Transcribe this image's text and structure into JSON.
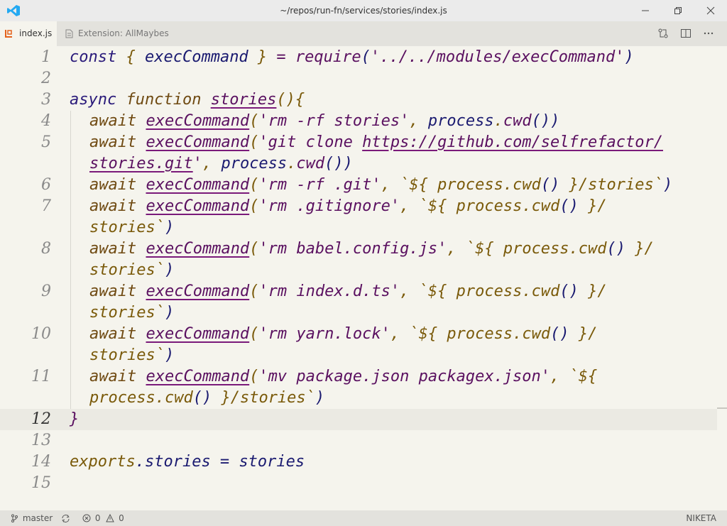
{
  "window": {
    "title": "~/repos/run-fn/services/stories/index.js"
  },
  "tabs": [
    {
      "label": "index.js",
      "active": true
    },
    {
      "label": "Extension: AllMaybes",
      "active": false
    }
  ],
  "editor": {
    "line_numbers": [
      "1",
      "2",
      "3",
      "4",
      "5",
      "",
      "6",
      "7",
      "",
      "8",
      "",
      "9",
      "",
      "10",
      "",
      "11",
      "",
      "12",
      "13",
      "14",
      "15"
    ],
    "current_line": "12"
  },
  "code": {
    "l1": {
      "const": "const ",
      "brace_open": "{ ",
      "ident": "execCommand",
      "brace_close": " }",
      "eq": " = ",
      "req": "require",
      "p_open": "(",
      "str": "'../../modules/execCommand'",
      "p_close": ")"
    },
    "l3": {
      "async": "async ",
      "function": "function ",
      "name": "stories",
      "parens": "()",
      "brace": "{"
    },
    "await": "await ",
    "call": "execCommand",
    "l4": {
      "open": "(",
      "str": "'rm -rf stories'",
      "comma": ", ",
      "proc": "process",
      "dot": ".",
      "cwd": "cwd",
      "close": "())"
    },
    "l5a": {
      "open": "(",
      "str": "'git clone ",
      "url": "https://github.com/selfrefactor/"
    },
    "l5b": {
      "url": "stories.git",
      "str": "'",
      "comma": ", ",
      "proc": "process",
      "dot": ".",
      "cwd": "cwd",
      "close": "())"
    },
    "l6": {
      "open": "(",
      "str": "'rm -rf .git'",
      "comma": ", ",
      "tpl1": "`${ ",
      "proc": "process",
      "dot": ".",
      "cwd": "cwd",
      "paren": "()",
      "tpl2": " }/stories`",
      "close": ")"
    },
    "l7a": {
      "open": "(",
      "str": "'rm .gitignore'",
      "comma": ", ",
      "tpl1": "`${ ",
      "proc": "process",
      "dot": ".",
      "cwd": "cwd",
      "paren": "()",
      "tpl2": " }/"
    },
    "l7b": {
      "tpl": "stories`",
      "close": ")"
    },
    "l8a": {
      "open": "(",
      "str": "'rm babel.config.js'",
      "comma": ", ",
      "tpl1": "`${ ",
      "proc": "process",
      "dot": ".",
      "cwd": "cwd",
      "paren": "()",
      "tpl2": " }/"
    },
    "l8b": {
      "tpl": "stories`",
      "close": ")"
    },
    "l9a": {
      "open": "(",
      "str": "'rm index.d.ts'",
      "comma": ", ",
      "tpl1": "`${ ",
      "proc": "process",
      "dot": ".",
      "cwd": "cwd",
      "paren": "()",
      "tpl2": " }/"
    },
    "l9b": {
      "tpl": "stories`",
      "close": ")"
    },
    "l10a": {
      "open": "(",
      "str": "'rm yarn.lock'",
      "comma": ", ",
      "tpl1": "`${ ",
      "proc": "process",
      "dot": ".",
      "cwd": "cwd",
      "paren": "()",
      "tpl2": " }/"
    },
    "l10b": {
      "tpl": "stories`",
      "close": ")"
    },
    "l11a": {
      "open": "(",
      "str": "'mv package.json packagex.json'",
      "comma": ", ",
      "tpl1": "`${"
    },
    "l11b": {
      "proc": "process",
      "dot": ".",
      "cwd": "cwd",
      "paren": "()",
      "tpl2": " }/stories`",
      "close": ")"
    },
    "l12": {
      "brace": "}"
    },
    "l14": {
      "exports": "exports",
      "dot": ".",
      "prop": "stories",
      "eq": " = ",
      "val": "stories"
    }
  },
  "statusbar": {
    "branch": "master",
    "errors": "0",
    "warnings": "0",
    "user": "NIKETA"
  },
  "colors": {
    "accent": "#23a9f2",
    "background": "#f5f4ed"
  }
}
